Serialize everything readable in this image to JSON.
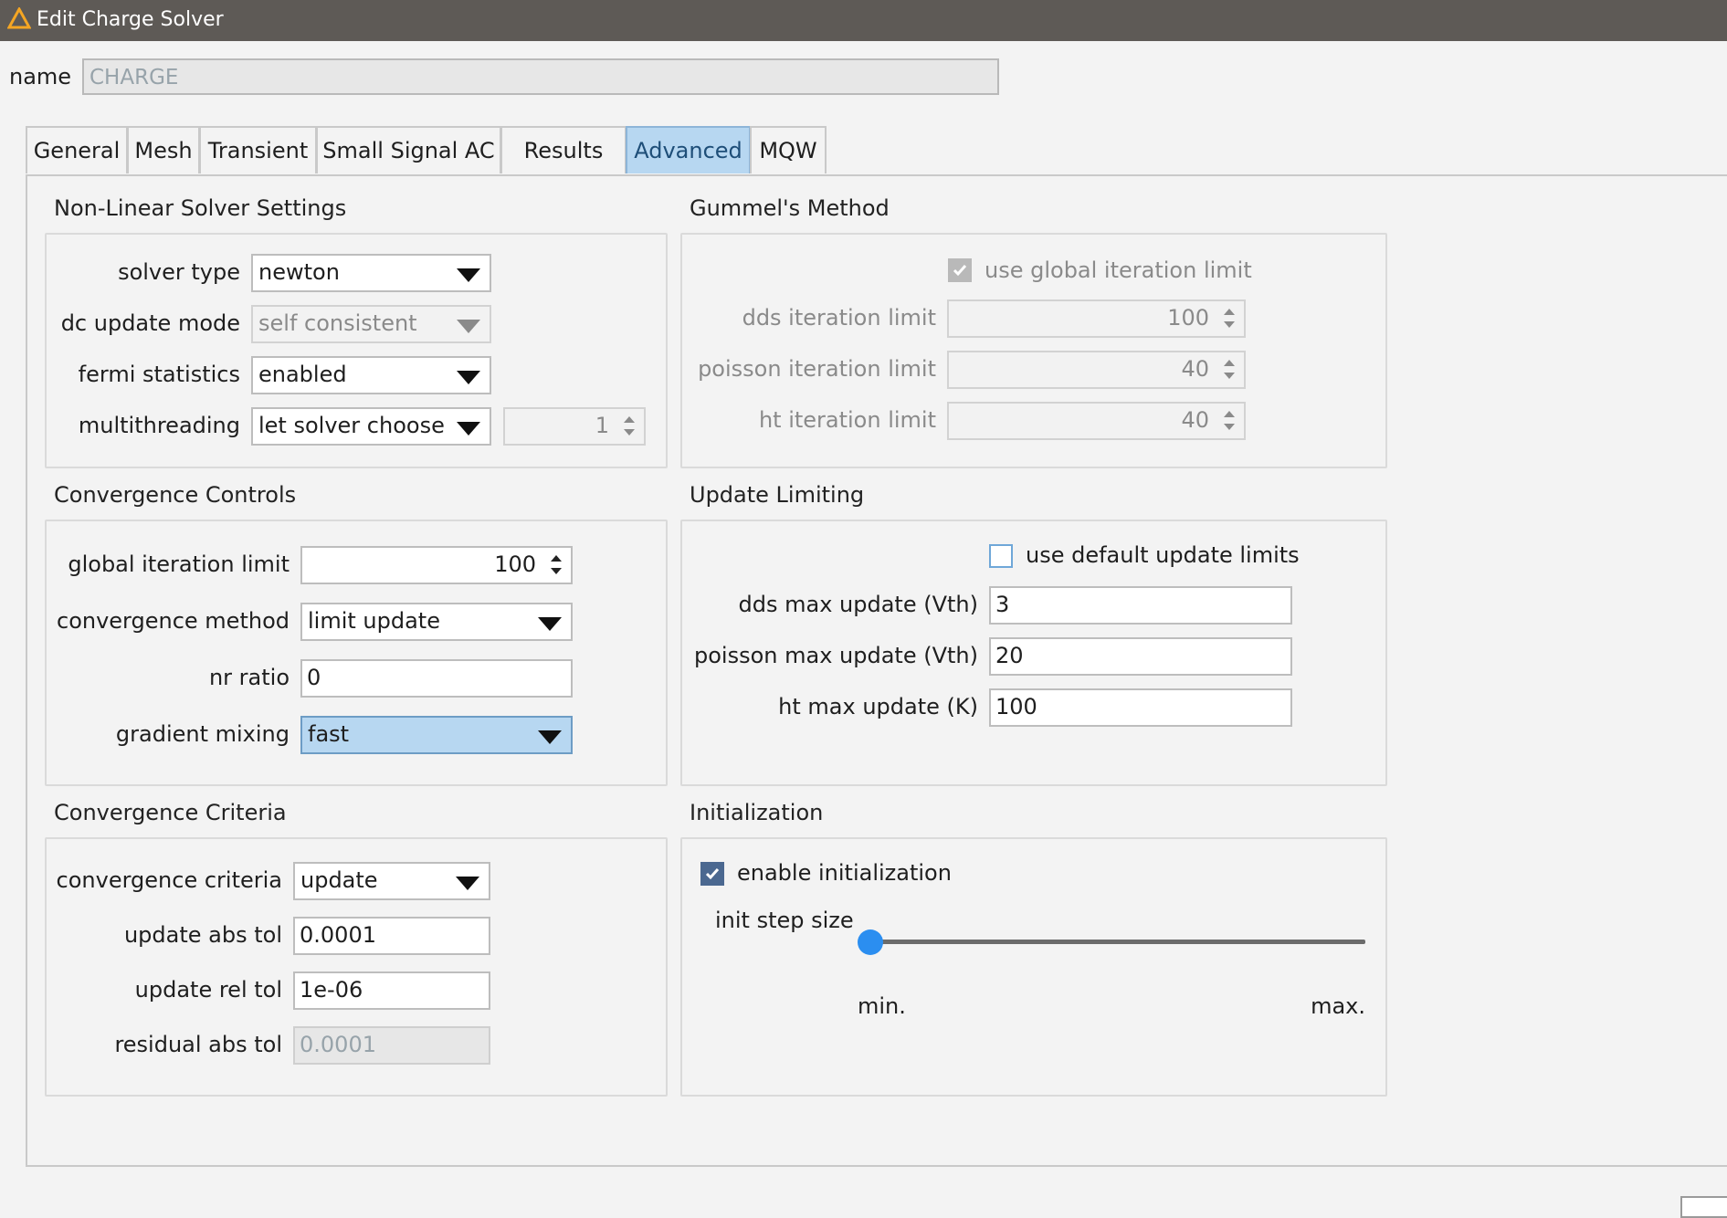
{
  "window": {
    "title": "Edit Charge Solver"
  },
  "name": {
    "label": "name",
    "value": "CHARGE"
  },
  "tabs": [
    {
      "label": "General"
    },
    {
      "label": "Mesh"
    },
    {
      "label": "Transient"
    },
    {
      "label": "Small Signal AC"
    },
    {
      "label": "Results"
    },
    {
      "label": "Advanced",
      "active": true
    },
    {
      "label": "MQW"
    }
  ],
  "nonlinear": {
    "title": "Non-Linear Solver Settings",
    "solver_type": {
      "label": "solver type",
      "value": "newton"
    },
    "dc_update_mode": {
      "label": "dc update mode",
      "value": "self consistent"
    },
    "fermi_statistics": {
      "label": "fermi statistics",
      "value": "enabled"
    },
    "multithreading": {
      "label": "multithreading",
      "value": "let solver choose",
      "threads": "1"
    }
  },
  "gummel": {
    "title": "Gummel's Method",
    "use_global": {
      "label": "use global iteration limit",
      "checked": true
    },
    "dds": {
      "label": "dds iteration limit",
      "value": "100"
    },
    "poisson": {
      "label": "poisson iteration limit",
      "value": "40"
    },
    "ht": {
      "label": "ht iteration limit",
      "value": "40"
    }
  },
  "convergence_controls": {
    "title": "Convergence Controls",
    "global_iteration_limit": {
      "label": "global iteration limit",
      "value": "100"
    },
    "convergence_method": {
      "label": "convergence method",
      "value": "limit update"
    },
    "nr_ratio": {
      "label": "nr ratio",
      "value": "0"
    },
    "gradient_mixing": {
      "label": "gradient mixing",
      "value": "fast"
    }
  },
  "update_limiting": {
    "title": "Update Limiting",
    "use_default": {
      "label": "use default update limits",
      "checked": false
    },
    "dds_max": {
      "label": "dds max update (Vth)",
      "value": "3"
    },
    "poisson_max": {
      "label": "poisson  max update (Vth)",
      "value": "20"
    },
    "ht_max": {
      "label": "ht max update (K)",
      "value": "100"
    }
  },
  "convergence_criteria": {
    "title": "Convergence Criteria",
    "criteria": {
      "label": "convergence criteria",
      "value": "update"
    },
    "update_abs_tol": {
      "label": "update abs tol",
      "value": "0.0001"
    },
    "update_rel_tol": {
      "label": "update rel tol",
      "value": "1e-06"
    },
    "residual_abs_tol": {
      "label": "residual abs tol",
      "value": "0.0001"
    }
  },
  "initialization": {
    "title": "Initialization",
    "enable": {
      "label": "enable initialization",
      "checked": true
    },
    "step_size": {
      "label": "init step size",
      "min_label": "min.",
      "max_label": "max.",
      "level": 0.0
    }
  },
  "colors": {
    "accent": "#2b8ef0",
    "selected": "#b7d7f1",
    "titlebar": "#5e5a56"
  }
}
